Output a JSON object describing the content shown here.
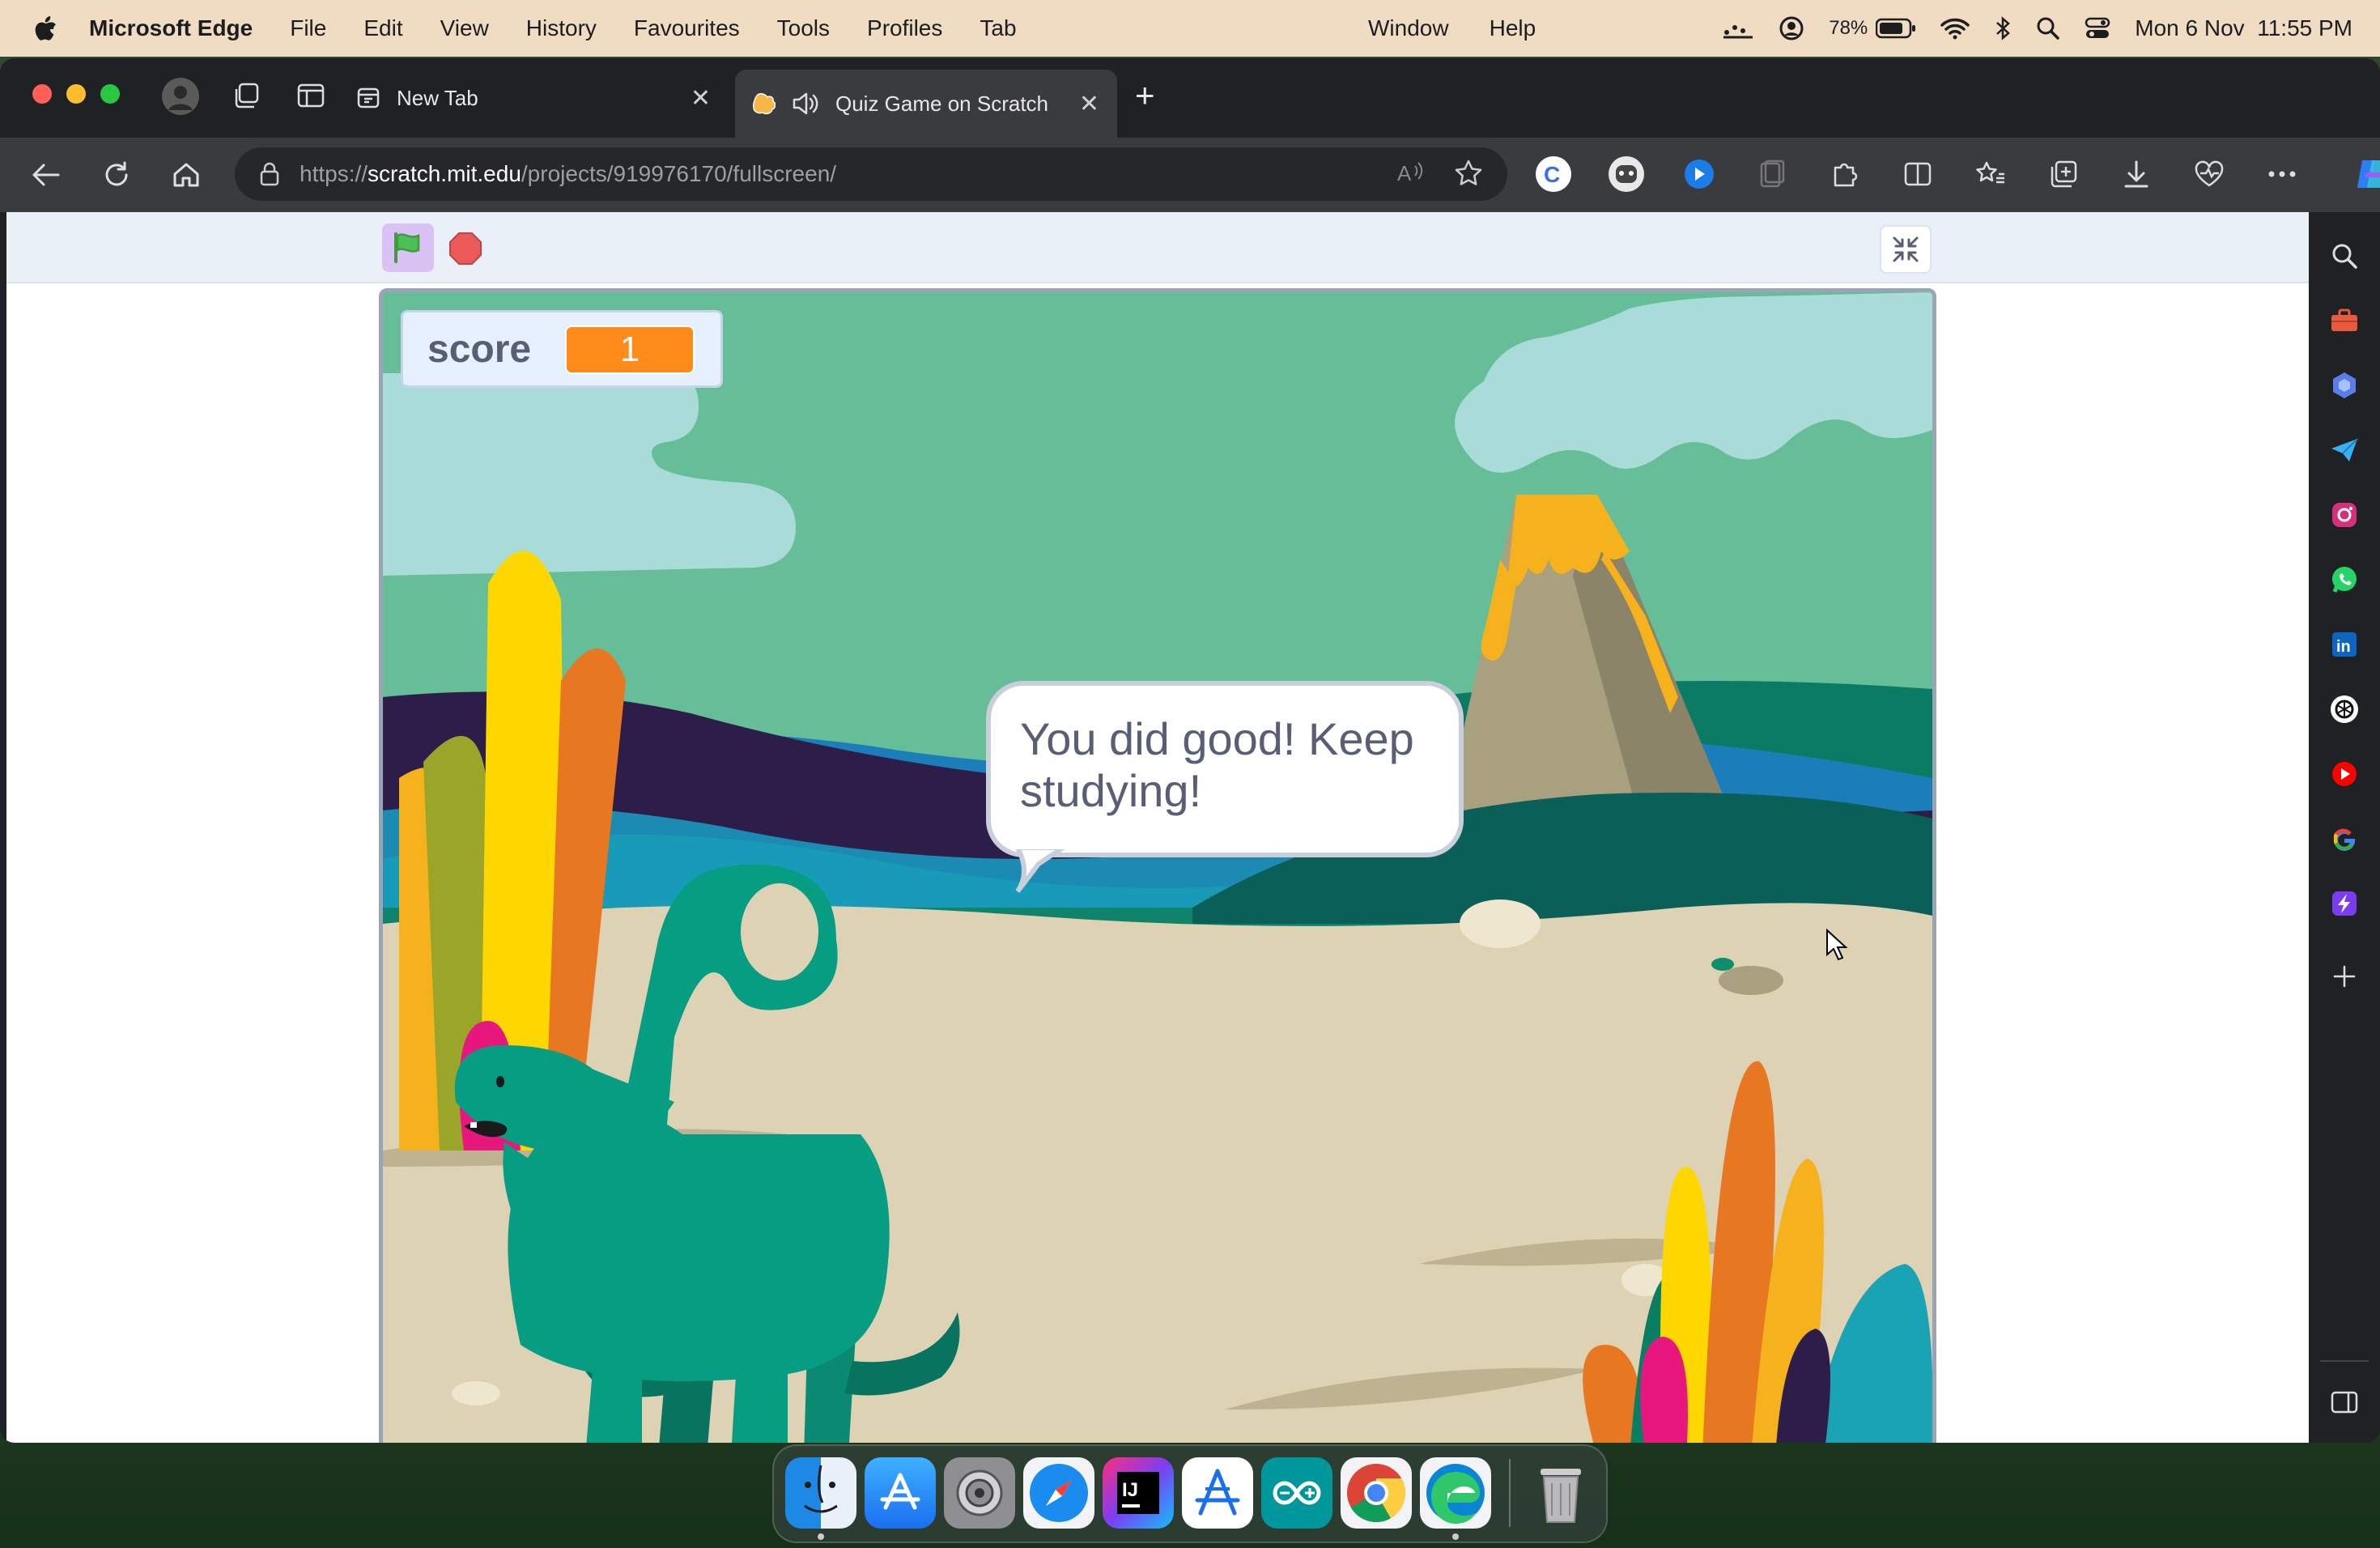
{
  "menubar": {
    "app_name": "Microsoft Edge",
    "menus": [
      "File",
      "Edit",
      "View",
      "History",
      "Favourites",
      "Tools",
      "Profiles",
      "Tab"
    ],
    "menus_right": [
      "Window",
      "Help"
    ],
    "battery_percent": "78%",
    "datetime": "Mon 6 Nov  11:55 PM"
  },
  "browser": {
    "tabs": [
      {
        "title": "New Tab",
        "active": false
      },
      {
        "title": "Quiz Game on Scratch",
        "active": true
      }
    ],
    "url_prefix": "https://",
    "url_host": "scratch.mit.edu",
    "url_path": "/projects/919976170/fullscreen/"
  },
  "stage": {
    "monitor_label": "score",
    "monitor_value": "1",
    "speech_text": "You did good! Keep studying!"
  },
  "colors": {
    "accent_orange": "#ff8c1a",
    "scratch_purple": "#d9c3f5",
    "sky": "#66be98"
  },
  "sidebar_icons": [
    "search-icon",
    "toolbox-icon",
    "copilot-icon",
    "send-icon",
    "instagram-icon",
    "whatsapp-icon",
    "linkedin-icon",
    "chatgpt-icon",
    "youtube-icon",
    "google-icon",
    "bolt-icon",
    "add-icon",
    "sidebar-toggle-icon",
    "settings-icon"
  ],
  "dock_apps": [
    "Finder",
    "App Store",
    "System Settings",
    "Safari",
    "IntelliJ IDEA",
    "Xcode Instruments",
    "Arduino",
    "Google Chrome",
    "Microsoft Edge",
    "Trash"
  ]
}
